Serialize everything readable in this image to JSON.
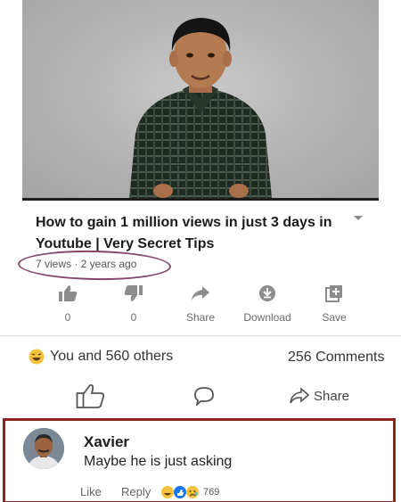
{
  "video": {
    "title": "How to gain 1 million views in just 3 days in Youtube | Very Secret Tips",
    "meta": "7 views · 2 years ago"
  },
  "actions": [
    {
      "icon": "thumbs-up-icon",
      "label": "0"
    },
    {
      "icon": "thumbs-down-icon",
      "label": "0"
    },
    {
      "icon": "share-icon",
      "label": "Share"
    },
    {
      "icon": "download-icon",
      "label": "Download"
    },
    {
      "icon": "save-icon",
      "label": "Save"
    }
  ],
  "facebook": {
    "reactions_text": "You and 560 others",
    "comments_count": "256 Comments",
    "share_label": "Share"
  },
  "comment": {
    "author": "Xavier",
    "text": "Maybe he is just asking",
    "like_label": "Like",
    "reply_label": "Reply",
    "reaction_count": "769"
  },
  "colors": {
    "highlight_circle": "#86466c",
    "comment_border": "#8d2222"
  }
}
